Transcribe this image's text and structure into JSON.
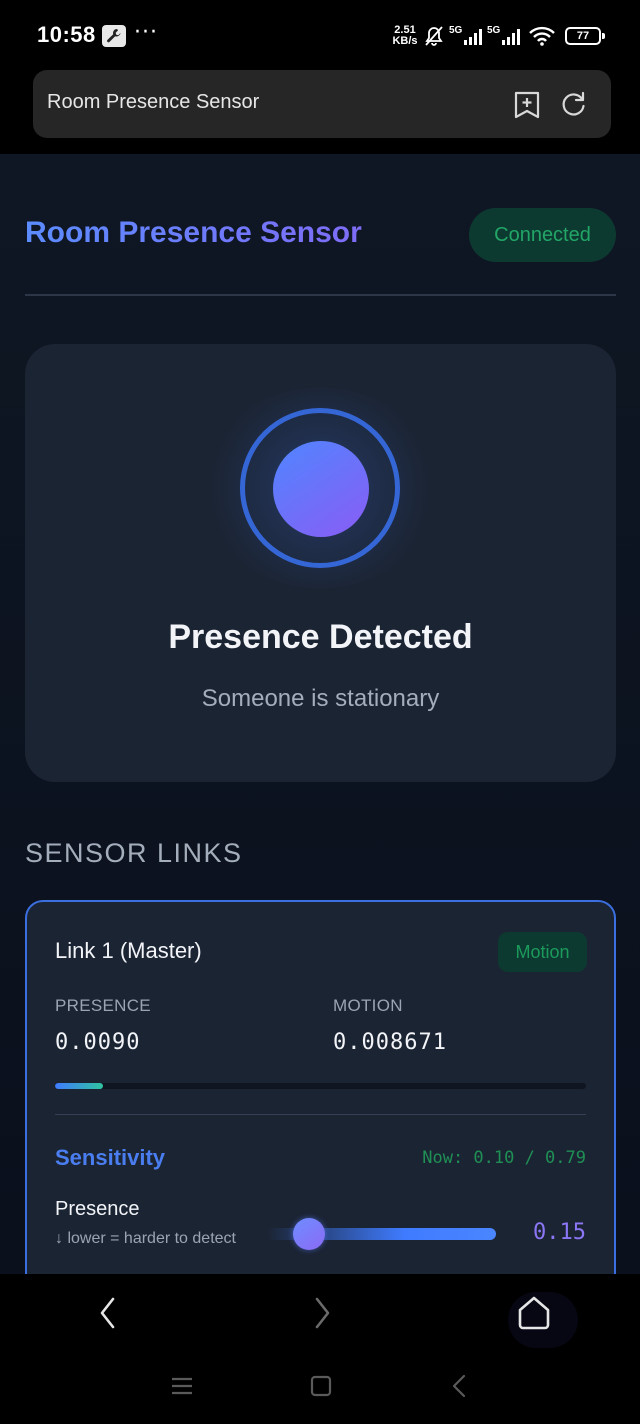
{
  "status_bar": {
    "time": "10:58",
    "more": "···",
    "speed_value": "2.51",
    "speed_unit": "KB/s",
    "net1": "5G",
    "net2": "5G",
    "battery": "77"
  },
  "browser": {
    "page_title": "Room Presence Sensor"
  },
  "header": {
    "title": "Room Presence Sensor",
    "status": "Connected"
  },
  "presence": {
    "title": "Presence Detected",
    "subtitle": "Someone is stationary"
  },
  "sensor_links": {
    "section_title": "SENSOR LINKS",
    "links": [
      {
        "name": "Link 1 (Master)",
        "badge": "Motion",
        "presence_label": "PRESENCE",
        "presence_value": "0.0090",
        "motion_label": "MOTION",
        "motion_value": "0.008671",
        "level_fraction": 0.09,
        "sensitivity_label": "Sensitivity",
        "sensitivity_now": "Now: 0.10 / 0.79",
        "presence_setting_label": "Presence",
        "presence_setting_hint": "↓ lower = harder to detect",
        "presence_setting_value": "0.15",
        "slider_fraction": 0.15
      }
    ]
  },
  "colors": {
    "accent": "#4a7ef0",
    "connected_green": "#22a567",
    "card_bg": "#1b2433",
    "page_bg": "#0f1724"
  }
}
